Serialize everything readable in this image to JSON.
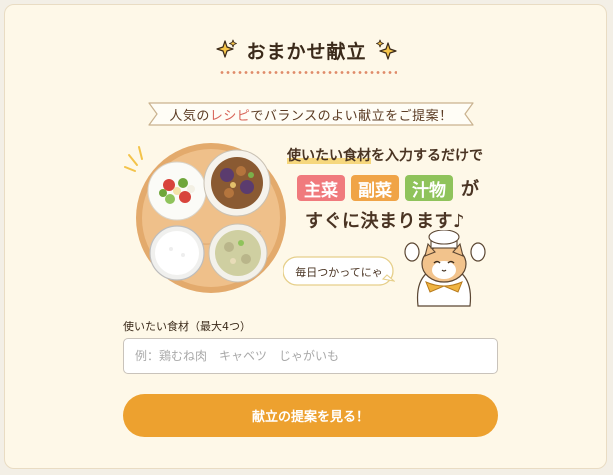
{
  "header": {
    "title": "おまかせ献立",
    "left_icon": "sparkle-icon",
    "right_icon": "sparkle-icon"
  },
  "banner": {
    "ribbon_before": "人気の",
    "ribbon_accent": "レシピ",
    "ribbon_after": "でバランスのよい献立をご提案！",
    "promo_highlight": "使いたい食材",
    "promo_rest": "を入力するだけで",
    "badges": [
      "主菜",
      "副菜",
      "汁物"
    ],
    "badge_suffix": "が",
    "promo_line3": "すぐに決まります♪",
    "speech_bubble": "毎日つかってにゃ"
  },
  "form": {
    "label": "使いたい食材（最大4つ）",
    "placeholder": "例：鶏むね肉　キャベツ　じゃがいも",
    "value": "",
    "submit_label": "献立の提案を見る！"
  },
  "colors": {
    "accent": "#eda12f",
    "main_dish": "#f07a7d",
    "side_dish": "#f0a447",
    "soup": "#8fc35b",
    "background": "#fef8e8"
  }
}
